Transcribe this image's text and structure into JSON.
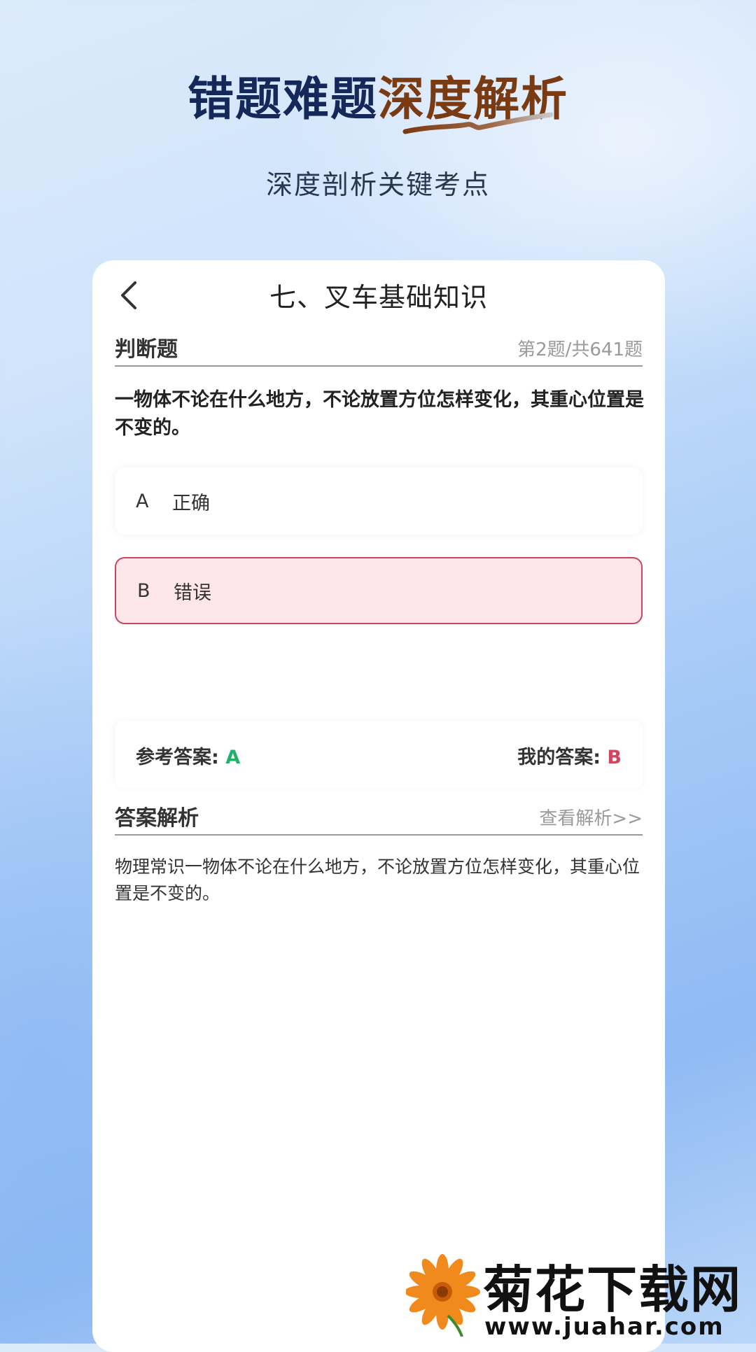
{
  "promo": {
    "headline_part1": "错题难题",
    "headline_part2": "深度解析",
    "subtitle": "深度剖析关键考点"
  },
  "nav": {
    "title": "七、叉车基础知识",
    "back_icon": "chevron-left-icon"
  },
  "question": {
    "type_label": "判断题",
    "progress": "第2题/共641题",
    "text": "一物体不论在什么地方，不论放置方位怎样变化，其重心位置是不变的。",
    "options": [
      {
        "key": "A",
        "text": "正确",
        "state": "normal"
      },
      {
        "key": "B",
        "text": "错误",
        "state": "wrong"
      }
    ]
  },
  "answers": {
    "reference_label": "参考答案: ",
    "reference_value": "A",
    "mine_label": "我的答案: ",
    "mine_value": "B"
  },
  "analysis": {
    "label": "答案解析",
    "link": "查看解析>>",
    "text": "物理常识一物体不论在什么地方，不论放置方位怎样变化，其重心位置是不变的。"
  },
  "watermark": {
    "brand": "菊花下载网",
    "url": "www.juahar.com"
  },
  "colors": {
    "headline_dark": "#15285a",
    "headline_accent": "#7b3b12",
    "correct": "#1fb16b",
    "wrong": "#d2455f",
    "wrong_bg": "#fde6ea"
  }
}
